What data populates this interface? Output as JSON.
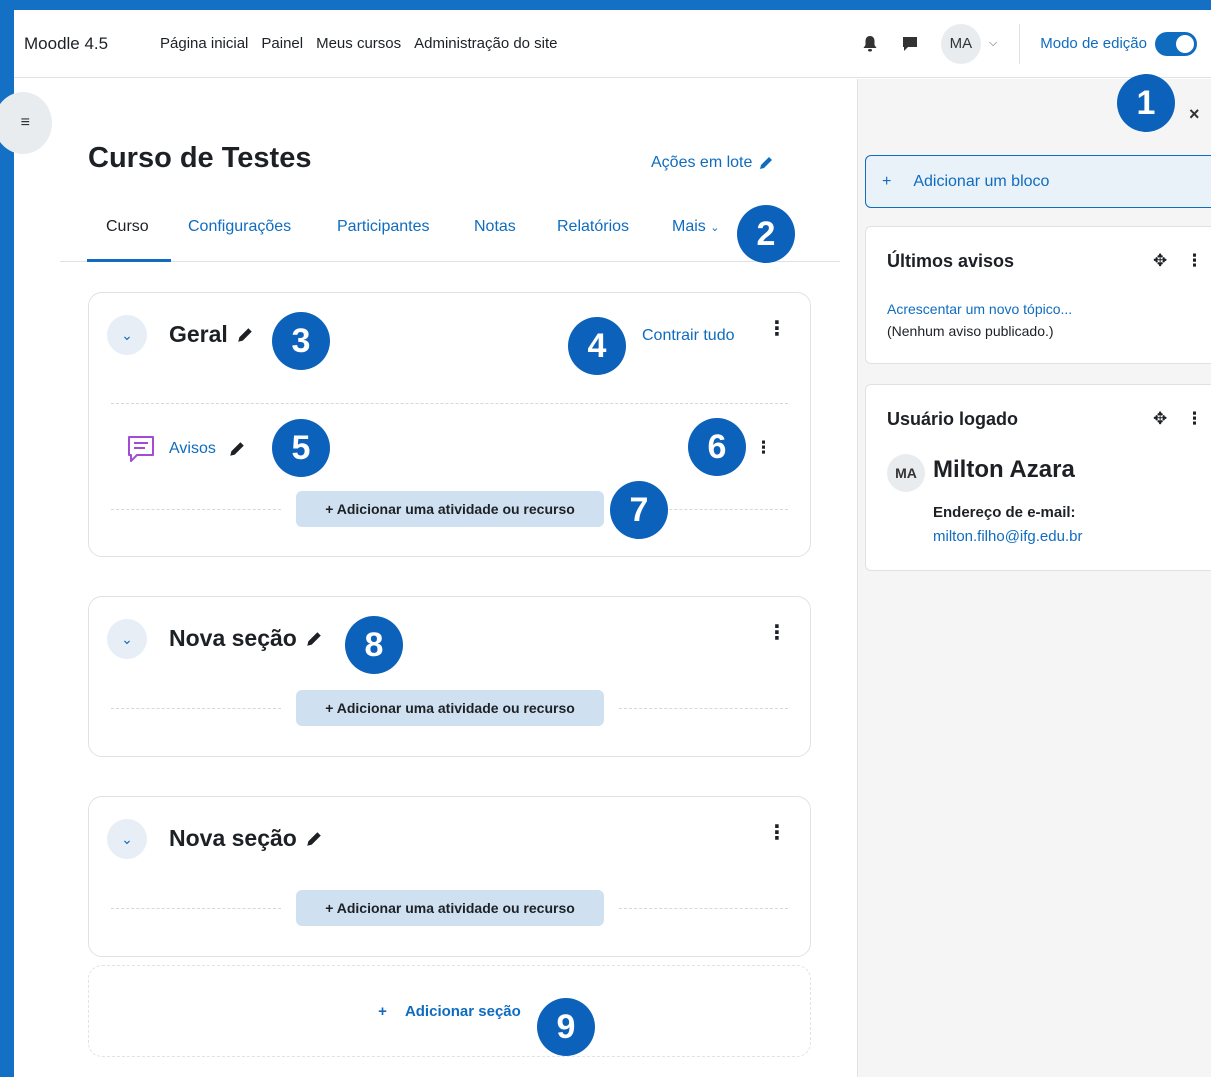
{
  "navbar": {
    "brand": "Moodle 4.5",
    "links": [
      "Página inicial",
      "Painel",
      "Meus cursos",
      "Administração do site"
    ],
    "user_initials": "MA",
    "edit_mode_label": "Modo de edição"
  },
  "course": {
    "title": "Curso de Testes",
    "bulk_actions": "Ações em lote",
    "tabs": [
      "Curso",
      "Configurações",
      "Participantes",
      "Notas",
      "Relatórios",
      "Mais"
    ]
  },
  "sections": [
    {
      "title": "Geral",
      "collapse_all": "Contrair tudo",
      "activity": "Avisos",
      "add_activity": "+ Adicionar uma atividade ou recurso"
    },
    {
      "title": "Nova seção",
      "add_activity": "+ Adicionar uma atividade ou recurso"
    },
    {
      "title": "Nova seção",
      "add_activity": "+ Adicionar uma atividade ou recurso"
    }
  ],
  "add_section": "Adicionar seção",
  "drawer": {
    "add_block": "Adicionar um bloco",
    "news_block": {
      "title": "Últimos avisos",
      "link": "Acrescentar um novo tópico...",
      "empty": "(Nenhum aviso publicado.)"
    },
    "user_block": {
      "title": "Usuário logado",
      "initials": "MA",
      "name": "Milton Azara",
      "email_label": "Endereço de e-mail:",
      "email": "milton.filho@ifg.edu.br"
    }
  },
  "callouts": [
    "1",
    "2",
    "3",
    "4",
    "5",
    "6",
    "7",
    "8",
    "9"
  ],
  "colors": {
    "frame": "#1370c4",
    "callout": "#0c62bb",
    "link": "#0f6cbf",
    "activity_icon": "#a44bd6"
  },
  "icons": [
    "bell-icon",
    "chat-icon",
    "chevron-down-icon",
    "drawer-list-icon",
    "pencil-icon",
    "kebab-icon",
    "forum-icon",
    "close-icon",
    "move-icon",
    "plus-icon"
  ]
}
